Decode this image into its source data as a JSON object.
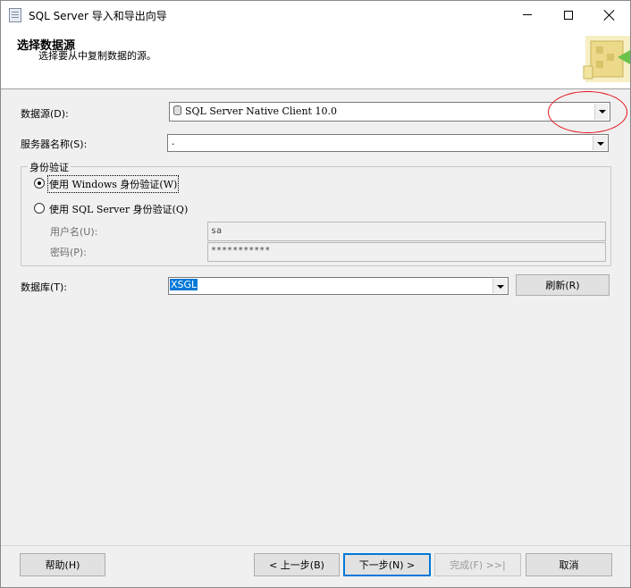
{
  "window": {
    "title": "SQL Server 导入和导出向导"
  },
  "header": {
    "title": "选择数据源",
    "subtitle": "选择要从中复制数据的源。"
  },
  "form": {
    "datasource_label": "数据源(D):",
    "datasource_value": "SQL Server Native Client 10.0",
    "server_label": "服务器名称(S):",
    "server_value": ".",
    "auth_group_title": "身份验证",
    "auth_windows_label": "使用 Windows 身份验证(W)",
    "auth_sql_label": "使用 SQL Server 身份验证(Q)",
    "auth_selected": "windows",
    "username_label": "用户名(U):",
    "username_value": "sa",
    "password_label": "密码(P):",
    "password_value": "***********",
    "database_label": "数据库(T):",
    "database_value": "XSGL",
    "refresh_label": "刷新(R)"
  },
  "footer": {
    "help_label": "帮助(H)",
    "back_label": "< 上一步(B)",
    "next_label": "下一步(N) >",
    "finish_label": "完成(F) >>|",
    "cancel_label": "取消"
  },
  "colors": {
    "annotation_circle": "#e3141c",
    "selection": "#0078d7",
    "accent_green": "#6cc24a"
  },
  "icons": {
    "app": "wizard-app-icon",
    "header_graphic": "datasource-wizard-graphic",
    "datasource": "database-cylinder-icon"
  }
}
